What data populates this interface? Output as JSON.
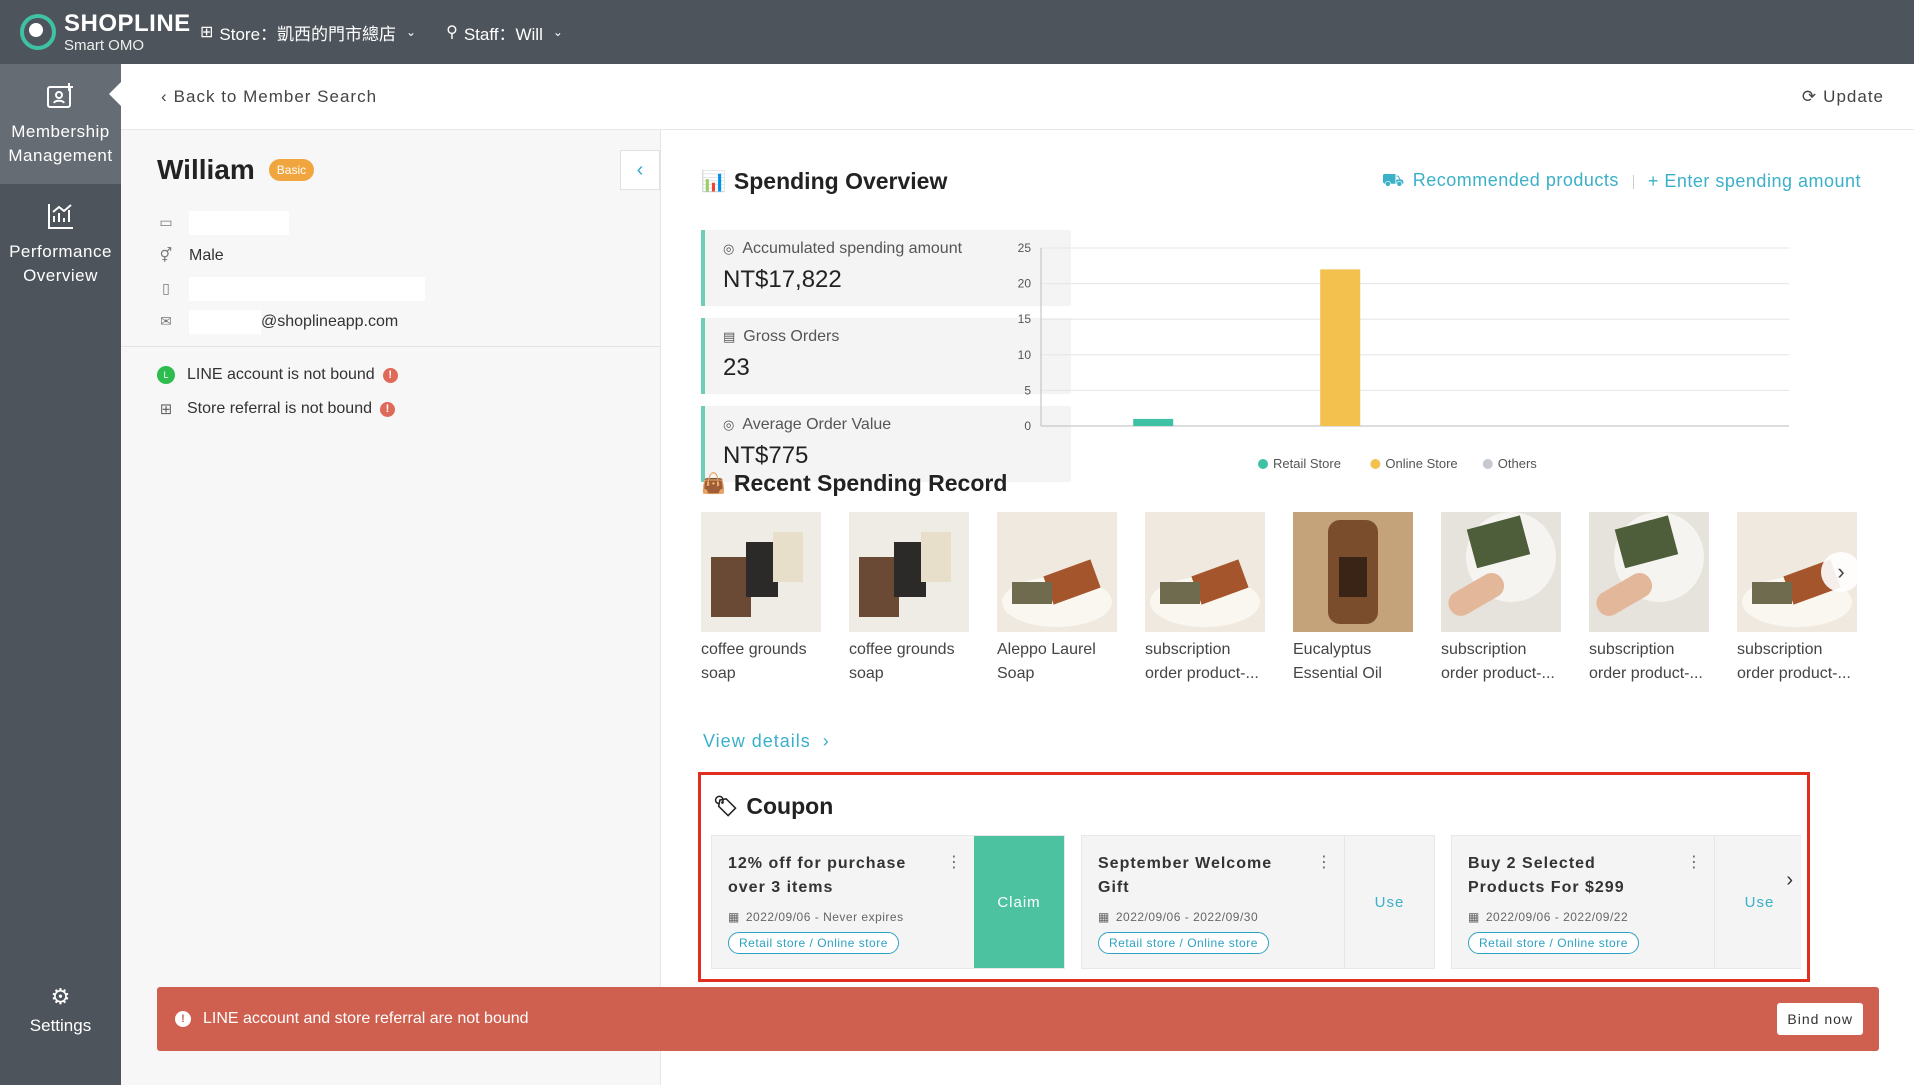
{
  "header": {
    "logo_title": "SHOPLINE",
    "logo_sub": "Smart OMO",
    "store": "Store：凱西的門市總店",
    "staff": "Staff：Will"
  },
  "sidebar": {
    "items": [
      {
        "line1": "Membership",
        "line2": "Management"
      },
      {
        "line1": "Performance",
        "line2": "Overview"
      }
    ],
    "settings": "Settings"
  },
  "topnav": {
    "back": "Back to Member Search",
    "update": "Update"
  },
  "member": {
    "name": "William",
    "tier": "Basic",
    "gender": "Male",
    "email": "@shoplineapp.com",
    "line_status": "LINE account is not bound",
    "store_status": "Store referral is not bound"
  },
  "spending": {
    "title": "Spending Overview",
    "link_recommended": "Recommended products",
    "link_enter": "+ Enter spending amount",
    "stats": [
      {
        "label": "Accumulated spending amount",
        "value": "NT$17,822"
      },
      {
        "label": "Gross Orders",
        "value": "23"
      },
      {
        "label": "Average Order Value",
        "value": "NT$775"
      }
    ]
  },
  "chart_data": {
    "type": "bar",
    "categories": [
      "Retail Store",
      "Online Store",
      "Others"
    ],
    "values": [
      1,
      22,
      0
    ],
    "ylim": [
      0,
      25
    ],
    "yticks": [
      0,
      5,
      10,
      15,
      20,
      25
    ],
    "grid": true,
    "legend": "bottom",
    "colors": [
      "#3fc1a4",
      "#f2c14e",
      "#c5c9d0"
    ]
  },
  "recent": {
    "title": "Recent Spending Record",
    "products": [
      {
        "line1": "coffee grounds",
        "line2": "soap"
      },
      {
        "line1": "coffee grounds",
        "line2": "soap"
      },
      {
        "line1": "Aleppo Laurel",
        "line2": "Soap"
      },
      {
        "line1": "subscription",
        "line2": "order product-..."
      },
      {
        "line1": "Eucalyptus",
        "line2": "Essential Oil"
      },
      {
        "line1": "subscription",
        "line2": "order product-..."
      },
      {
        "line1": "subscription",
        "line2": "order product-..."
      },
      {
        "line1": "subscription",
        "line2": "order product-..."
      }
    ],
    "view_details": "View details"
  },
  "coupon": {
    "title": "Coupon",
    "items": [
      {
        "name": "12% off for purchase over 3 items",
        "date": "2022/09/06 - Never expires",
        "tag": "Retail store / Online store",
        "action": "Claim"
      },
      {
        "name": "September Welcome Gift",
        "date": "2022/09/06 - 2022/09/30",
        "tag": "Retail store / Online store",
        "action": "Use"
      },
      {
        "name": "Buy 2 Selected Products For $299",
        "date": "2022/09/06 - 2022/09/22",
        "tag": "Retail store / Online store",
        "action": "Use"
      }
    ]
  },
  "alert": {
    "message": "LINE account and store referral are not bound",
    "button": "Bind now"
  }
}
